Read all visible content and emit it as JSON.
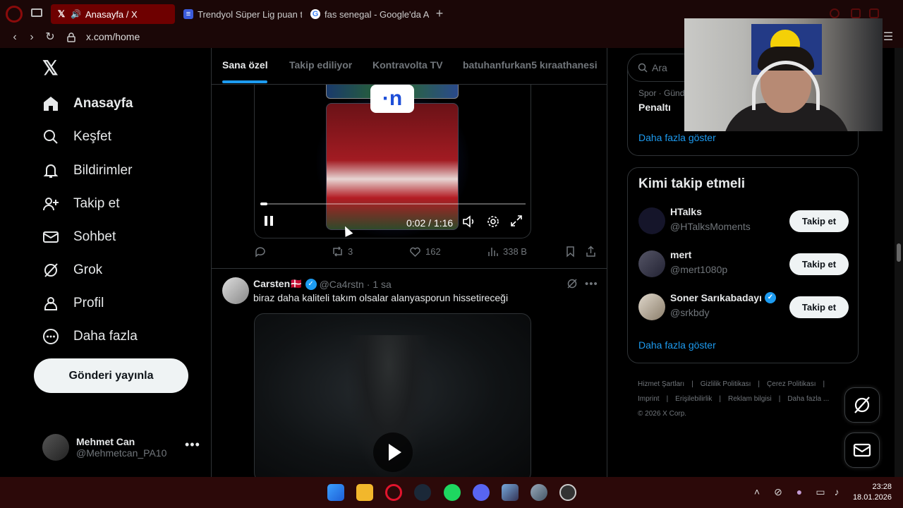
{
  "browser": {
    "tabs": [
      {
        "title": "Anasayfa / X",
        "active": true
      },
      {
        "title": "Trendyol Süper Lig puan t",
        "active": false
      },
      {
        "title": "fas senegal - Google'da Ar",
        "active": false
      }
    ],
    "new_tab_symbol": "+",
    "url": "x.com/home"
  },
  "nav": {
    "items": [
      {
        "label": "Anasayfa",
        "icon": "home-icon"
      },
      {
        "label": "Keşfet",
        "icon": "search-icon"
      },
      {
        "label": "Bildirimler",
        "icon": "bell-icon"
      },
      {
        "label": "Takip et",
        "icon": "add-user-icon"
      },
      {
        "label": "Sohbet",
        "icon": "mail-icon"
      },
      {
        "label": "Grok",
        "icon": "grok-icon"
      },
      {
        "label": "Profil",
        "icon": "person-icon"
      },
      {
        "label": "Daha fazla",
        "icon": "more-circle-icon"
      }
    ],
    "post_button": "Gönderi yayınla",
    "user": {
      "name": "Mehmet Can",
      "handle": "@Mehmetcan_PA10"
    }
  },
  "feed": {
    "tabs": [
      "Sana özel",
      "Takip ediliyor",
      "Kontravolta TV",
      "batuhanfurkan5 kıraathanesi"
    ],
    "post1": {
      "video_logo": "·n",
      "time": "0:02 / 1:16",
      "progress": 0.026,
      "retweets": "3",
      "likes": "162",
      "views": "338 B"
    },
    "post2": {
      "name": "Carsten🇩🇰",
      "handle": "@Ca4rstn",
      "age": "· 1 sa",
      "text": "biraz daha kaliteli takım olsalar alanyasporun hissetireceği"
    }
  },
  "sidebar": {
    "search_placeholder": "Ara",
    "trend_meta": "Spor · Gündem",
    "trend_name": "Penaltı",
    "show_more": "Daha fazla göster",
    "who_title": "Kimi takip etmeli",
    "who": [
      {
        "name": "HTalks",
        "handle": "@HTalksMoments",
        "button": "Takip et",
        "verified": false
      },
      {
        "name": "mert",
        "handle": "@mert1080p",
        "button": "Takip et",
        "verified": false
      },
      {
        "name": "Soner Sarıkabadayı",
        "handle": "@srkbdy",
        "button": "Takip et",
        "verified": true
      }
    ],
    "who_show_more": "Daha fazla göster",
    "footer_links": [
      "Hizmet Şartları",
      "|",
      "Gizlilik Politikası",
      "|",
      "Çerez Politikası",
      "|",
      "Imprint",
      "|",
      "Erişilebilirlik",
      "|",
      "Reklam bilgisi",
      "|",
      "Daha fazla ..."
    ],
    "copyright": "© 2026 X Corp."
  },
  "taskbar": {
    "time": "23:28",
    "date": "18.01.2026"
  },
  "colors": {
    "accent": "#1d9bf0",
    "browser_bg": "#1b0707",
    "active_tab": "#6e0000",
    "taskbar": "#2c0909"
  }
}
